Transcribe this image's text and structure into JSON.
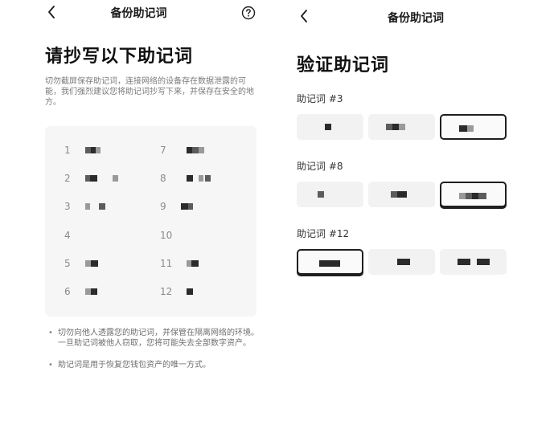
{
  "left": {
    "nav": {
      "title": "备份助记词"
    },
    "heading": "请抄写以下助记词",
    "description": "切勿截屏保存助记词，连接网络的设备存在数据泄露的可能，我们强烈建议您将助记词抄写下来，并保存在安全的地方。",
    "words": [
      {
        "num": "1"
      },
      {
        "num": "7"
      },
      {
        "num": "2"
      },
      {
        "num": "8"
      },
      {
        "num": "3"
      },
      {
        "num": "9"
      },
      {
        "num": "4"
      },
      {
        "num": "10"
      },
      {
        "num": "5"
      },
      {
        "num": "11"
      },
      {
        "num": "6"
      },
      {
        "num": "12"
      }
    ],
    "tips": [
      "切勿向他人透露您的助记词，并保管在隔离网络的环境。一旦助记词被他人窃取，您将可能失去全部数字资产。",
      "助记词是用于恢复您钱包资产的唯一方式。"
    ]
  },
  "right": {
    "nav": {
      "title": "备份助记词"
    },
    "heading": "验证助记词",
    "questions": [
      {
        "label": "助记词 #3",
        "selected_index": 2
      },
      {
        "label": "助记词 #8",
        "selected_index": 2
      },
      {
        "label": "助记词 #12",
        "selected_index": 0
      }
    ]
  }
}
